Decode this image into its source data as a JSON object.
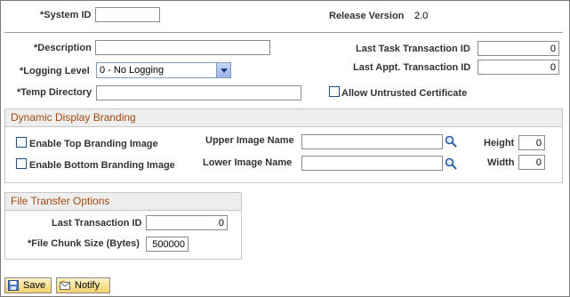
{
  "system": {
    "system_id_label": "System ID",
    "system_id_value": "",
    "release_label": "Release Version",
    "release_value": "2.0"
  },
  "form": {
    "description_label": "Description",
    "description_value": "",
    "logging_label": "Logging Level",
    "logging_value": "0 - No Logging",
    "temp_label": "Temp Directory",
    "temp_value": "",
    "last_task_label": "Last Task Transaction ID",
    "last_task_value": "0",
    "last_appt_label": "Last Appt. Transaction ID",
    "last_appt_value": "0",
    "allow_cert_label": "Allow Untrusted Certificate",
    "required_marker": "*"
  },
  "branding": {
    "title": "Dynamic Display Branding",
    "top_label": "Enable Top Branding Image",
    "bottom_label": "Enable Bottom Branding Image",
    "upper_label": "Upper Image Name",
    "upper_value": "",
    "lower_label": "Lower Image Name",
    "lower_value": "",
    "height_label": "Height",
    "height_value": "0",
    "width_label": "Width",
    "width_value": "0"
  },
  "transfer": {
    "title": "File Transfer Options",
    "last_tx_label": "Last Transaction ID",
    "last_tx_value": "0",
    "chunk_label": "File Chunk Size (Bytes)",
    "chunk_value": "500000"
  },
  "toolbar": {
    "save_label": "Save",
    "notify_label": "Notify"
  },
  "icons": {
    "lookup": "magnifier-icon",
    "save": "save-disk-icon",
    "notify": "notify-icon"
  }
}
